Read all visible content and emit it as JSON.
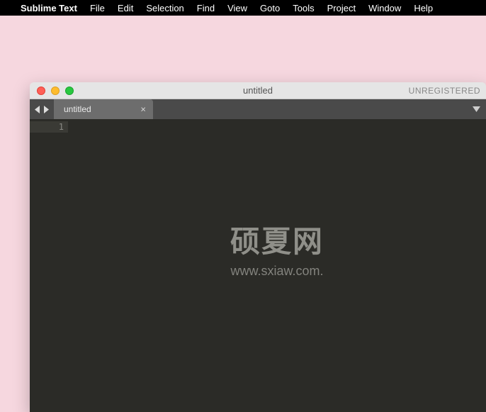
{
  "menubar": {
    "app": "Sublime Text",
    "items": [
      "File",
      "Edit",
      "Selection",
      "Find",
      "View",
      "Goto",
      "Tools",
      "Project",
      "Window",
      "Help"
    ]
  },
  "window": {
    "title": "untitled",
    "status": "UNREGISTERED"
  },
  "tabs": [
    {
      "label": "untitled"
    }
  ],
  "editor": {
    "line_number": "1"
  },
  "watermark": {
    "main": "硕夏网",
    "sub": "www.sxiaw.com."
  }
}
